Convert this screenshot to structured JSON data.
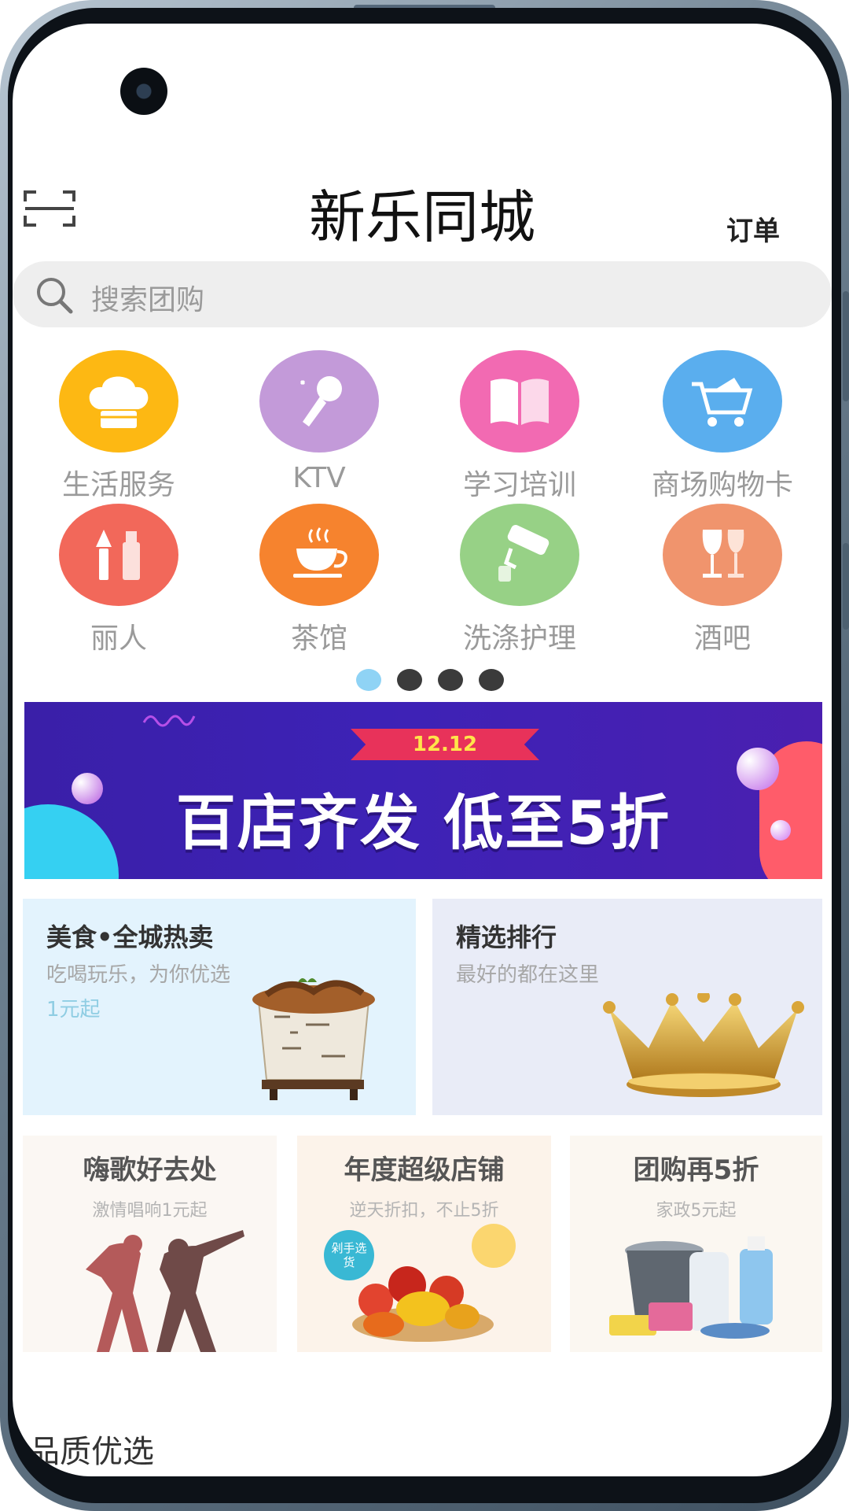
{
  "header": {
    "title": "新乐同城",
    "order_label": "订单",
    "scan_icon": "scan-icon"
  },
  "search": {
    "placeholder": "搜索团购",
    "icon": "search-icon"
  },
  "categories": [
    {
      "label": "生活服务",
      "icon": "chef-hat-icon",
      "color": "#fdb813"
    },
    {
      "label": "KTV",
      "icon": "microphone-icon",
      "color": "#c39ad9"
    },
    {
      "label": "学习培训",
      "icon": "book-icon",
      "color": "#f26ab2"
    },
    {
      "label": "商场购物卡",
      "icon": "shopping-cart-icon",
      "color": "#5aaeee"
    },
    {
      "label": "丽人",
      "icon": "cosmetics-icon",
      "color": "#f2685a"
    },
    {
      "label": "茶馆",
      "icon": "tea-cup-icon",
      "color": "#f6832e"
    },
    {
      "label": "洗涤护理",
      "icon": "paint-roller-icon",
      "color": "#97d186"
    },
    {
      "label": "酒吧",
      "icon": "wine-glass-icon",
      "color": "#f0946d"
    }
  ],
  "pager": {
    "count": 4,
    "active": 0
  },
  "banner": {
    "ribbon": "12.12",
    "headline": "百店齐发 低至5折"
  },
  "features": [
    {
      "title": "美食•全城热卖",
      "subtitle": "吃喝玩乐，为你优选",
      "price": "1元起"
    },
    {
      "title": "精选排行",
      "subtitle": "最好的都在这里"
    }
  ],
  "promos": [
    {
      "title": "嗨歌好去处",
      "subtitle": "激情唱响1元起"
    },
    {
      "title": "年度超级店铺",
      "subtitle": "逆天折扣，不止5折",
      "badge": "剁手选货"
    },
    {
      "title": "团购再5折",
      "subtitle": "家政5元起"
    }
  ],
  "section": {
    "title": "品质优选"
  }
}
